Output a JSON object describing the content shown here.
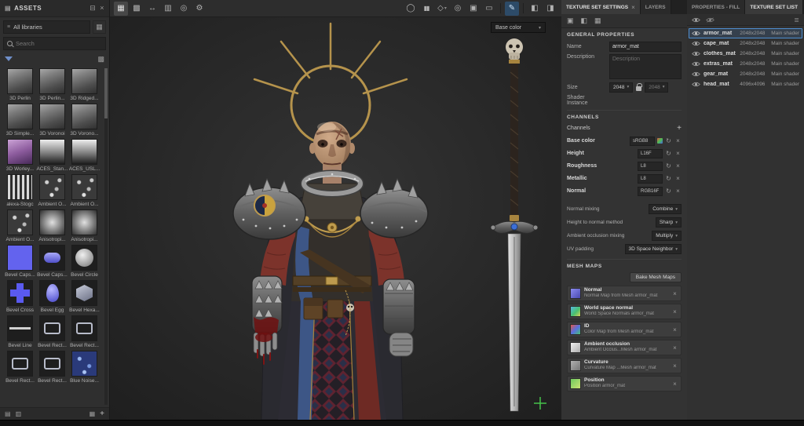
{
  "icons": {
    "caret": "▾",
    "close": "×",
    "plus": "+",
    "refresh": "↻",
    "menu": "≣",
    "list": "≡",
    "dock": "⊟",
    "grid": "▦",
    "grid_dense": "▩",
    "rows": "▤",
    "columns": "▥",
    "mirror": "↔",
    "target": "◎",
    "gear": "⚙",
    "pause": "▮▮",
    "shape": "◇",
    "circle": "◯",
    "camera": "▣",
    "display": "▭",
    "pencil": "✎",
    "panel_left": "◧",
    "panel_right": "◨"
  },
  "assets": {
    "title": "ASSETS",
    "library": "All libraries",
    "search_placeholder": "Search",
    "items": [
      {
        "name": "3D Perlin",
        "thumb": "cube"
      },
      {
        "name": "3D Perlin...",
        "thumb": "cube"
      },
      {
        "name": "3D Ridged...",
        "thumb": "cube"
      },
      {
        "name": "3D Simple...",
        "thumb": "cube"
      },
      {
        "name": "3D Voronoi",
        "thumb": "cube"
      },
      {
        "name": "3D Vorono...",
        "thumb": "cube"
      },
      {
        "name": "3D Worley...",
        "thumb": "cube-purple"
      },
      {
        "name": "ACES_Stan...",
        "thumb": "gradient"
      },
      {
        "name": "ACES_USL...",
        "thumb": "gradient"
      },
      {
        "name": "alexa-Stogc",
        "thumb": "stripes"
      },
      {
        "name": "Ambient O...",
        "thumb": "noise"
      },
      {
        "name": "Ambient O...",
        "thumb": "noise"
      },
      {
        "name": "Ambient O...",
        "thumb": "noise"
      },
      {
        "name": "Anisotropi...",
        "thumb": "radial"
      },
      {
        "name": "Anisotropi...",
        "thumb": "radial"
      },
      {
        "name": "Bevel Caps...",
        "thumb": "blue-square"
      },
      {
        "name": "Bevel Caps...",
        "thumb": "capsule"
      },
      {
        "name": "Bevel Circle",
        "thumb": "circle"
      },
      {
        "name": "Bevel Cross",
        "thumb": "cross"
      },
      {
        "name": "Bevel Egg",
        "thumb": "egg"
      },
      {
        "name": "Bevel Hexa...",
        "thumb": "hexagon"
      },
      {
        "name": "Bevel Line",
        "thumb": "line"
      },
      {
        "name": "Bevel Rect...",
        "thumb": "rect"
      },
      {
        "name": "Bevel Rect...",
        "thumb": "rect"
      },
      {
        "name": "Bevel Rect...",
        "thumb": "rect"
      },
      {
        "name": "Bevel Rect...",
        "thumb": "rect"
      },
      {
        "name": "Blue Noise...",
        "thumb": "blue-noise"
      }
    ]
  },
  "viewport": {
    "channel": "Base color"
  },
  "tss": {
    "tab_settings": "TEXTURE SET SETTINGS",
    "tab_layers": "LAYERS",
    "general_header": "GENERAL PROPERTIES",
    "name_label": "Name",
    "name_value": "armor_mat",
    "desc_label": "Description",
    "desc_placeholder": "Description",
    "size_label": "Size",
    "size_value": "2048",
    "size_value_locked": "2048",
    "shader_label": "Shader Instance",
    "channels_header": "CHANNELS",
    "channels_label": "Channels",
    "channels": [
      {
        "name": "Base color",
        "format": "sRGB8"
      },
      {
        "name": "Height",
        "format": "L16F"
      },
      {
        "name": "Roughness",
        "format": "L8"
      },
      {
        "name": "Metallic",
        "format": "L8"
      },
      {
        "name": "Normal",
        "format": "RGB16F"
      }
    ],
    "mixing": [
      {
        "label": "Normal mixing",
        "value": "Combine"
      },
      {
        "label": "Height to normal method",
        "value": "Sharp"
      },
      {
        "label": "Ambient occlusion mixing",
        "value": "Multiply"
      },
      {
        "label": "UV padding",
        "value": "3D Space Neighbor"
      }
    ],
    "meshmaps_header": "MESH MAPS",
    "bake_button": "Bake Mesh Maps",
    "meshmaps": [
      {
        "title": "Normal",
        "subtitle": "Normal Map from Mesh armor_mat",
        "thumb": "normal"
      },
      {
        "title": "World space normal",
        "subtitle": "World Space Normals armor_mat",
        "thumb": "wsnormal"
      },
      {
        "title": "ID",
        "subtitle": "Color Map from Mesh armor_mat",
        "thumb": "id"
      },
      {
        "title": "Ambient occlusion",
        "subtitle": "Ambient Occlus...Mesh armor_mat",
        "thumb": "ao"
      },
      {
        "title": "Curvature",
        "subtitle": "Curvature Map ...Mesh armor_mat",
        "thumb": "curvature"
      },
      {
        "title": "Position",
        "subtitle": "Position armor_mat",
        "thumb": "position"
      }
    ]
  },
  "tsl": {
    "tab_properties": "PROPERTIES - FILL",
    "tab_list": "TEXTURE SET LIST",
    "rows": [
      {
        "name": "armor_mat",
        "resolution": "2048x2048",
        "shader": "Main shader"
      },
      {
        "name": "cape_mat",
        "resolution": "2048x2048",
        "shader": "Main shader"
      },
      {
        "name": "clothes_mat",
        "resolution": "2048x2048",
        "shader": "Main shader"
      },
      {
        "name": "extras_mat",
        "resolution": "2048x2048",
        "shader": "Main shader"
      },
      {
        "name": "gear_mat",
        "resolution": "2048x2048",
        "shader": "Main shader"
      },
      {
        "name": "head_mat",
        "resolution": "4096x4096",
        "shader": "Main shader"
      }
    ]
  }
}
